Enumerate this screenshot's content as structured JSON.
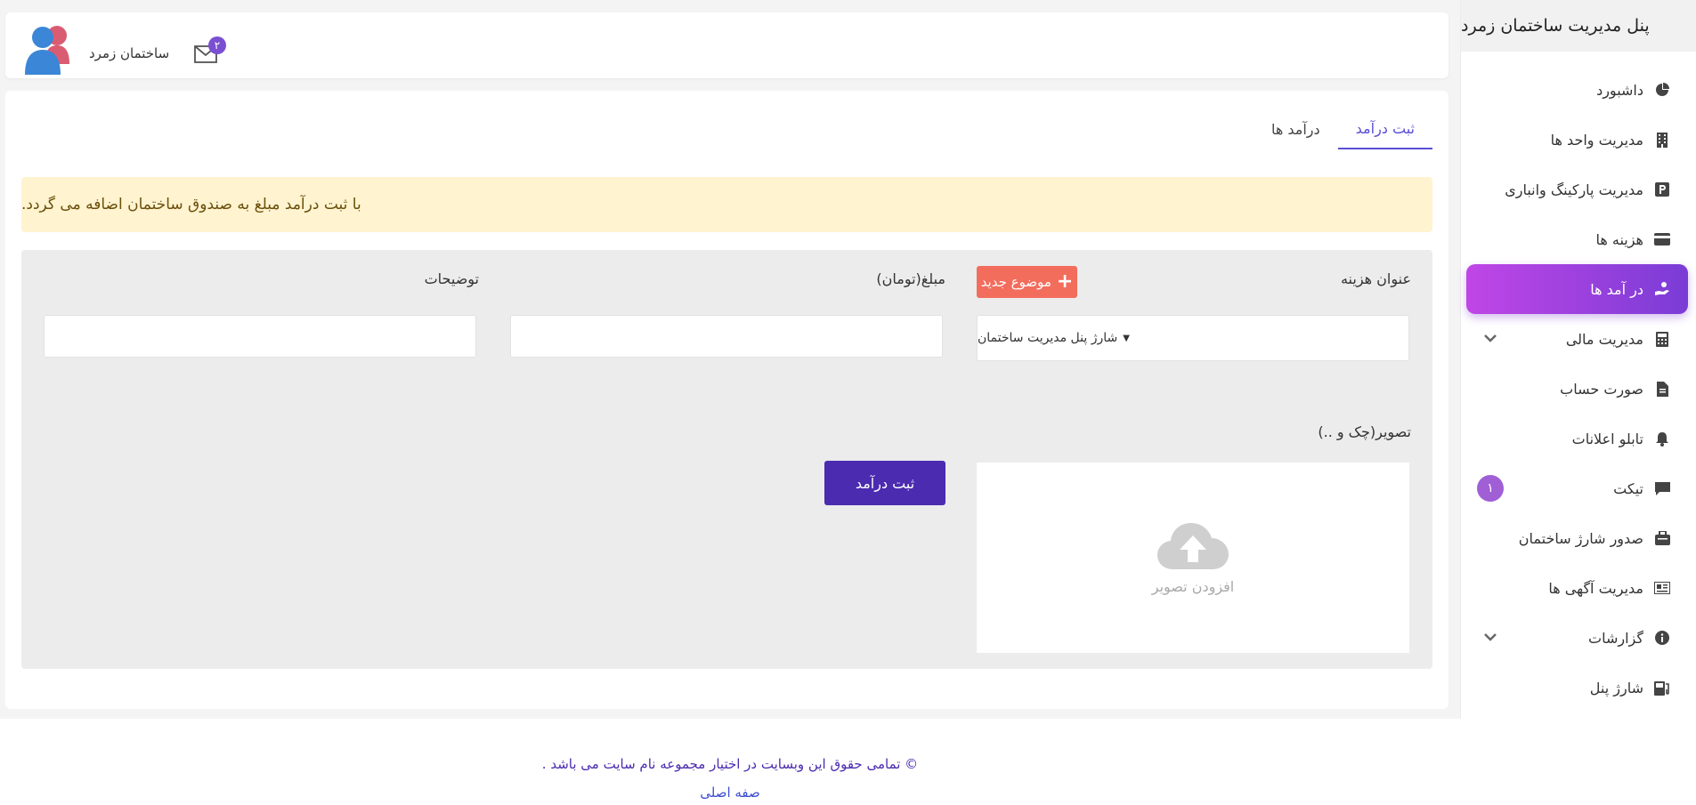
{
  "app": {
    "title": "پنل مدیریت ساختمان زمرد"
  },
  "sidebar": {
    "items": [
      {
        "label": "داشبورد",
        "icon": "pie-chart-icon"
      },
      {
        "label": "مدیریت واحد ها",
        "icon": "building-icon"
      },
      {
        "label": "مدیریت پارکینگ وانباری",
        "icon": "parking-icon"
      },
      {
        "label": "هزینه ها",
        "icon": "credit-card-icon"
      },
      {
        "label": "در آمد ها",
        "icon": "hand-coin-icon",
        "active": true
      },
      {
        "label": "مدیریت مالی",
        "icon": "calculator-icon",
        "expandable": true
      },
      {
        "label": "صورت حساب",
        "icon": "document-icon"
      },
      {
        "label": "تابلو اعلانات",
        "icon": "bell-icon"
      },
      {
        "label": "تیکت",
        "icon": "chat-icon",
        "badge": "۱"
      },
      {
        "label": "صدور شارژ ساختمان",
        "icon": "briefcase-icon"
      },
      {
        "label": "مدیریت آگهی ها",
        "icon": "newspaper-icon"
      },
      {
        "label": "گزارشات",
        "icon": "info-icon",
        "expandable": true
      },
      {
        "label": "شارژ پنل",
        "icon": "charge-icon"
      }
    ]
  },
  "header": {
    "username": "ساختمان زمرد",
    "mail_count": "۲"
  },
  "tabs": [
    {
      "label": "ثبت درآمد",
      "active": true
    },
    {
      "label": "درآمد ها",
      "active": false
    }
  ],
  "alert": {
    "text": "با ثبت درآمد مبلغ به صندوق ساختمان اضافه می گردد."
  },
  "form": {
    "expense_title_label": "عنوان هزینه",
    "new_topic_label": "موضوع جدید",
    "selected_topic": "شارژ پنل مدیریت ساختمان",
    "amount_label": "مبلغ(تومان)",
    "amount_value": "",
    "description_label": "توضیحات",
    "description_value": "",
    "image_label": "تصویر(چک و ..)",
    "upload_text": "افزودن تصویر",
    "submit_label": "ثبت درآمد"
  },
  "footer": {
    "copyright": "© تمامی حقوق این وبسایت در اختیار مجموعه نام سایت می باشد .",
    "home_link": "صفه اصلی"
  },
  "colors": {
    "accent": "#7a3cd6",
    "accent_gradient_start": "#c046e6",
    "primary_button": "#4b2bb0",
    "new_topic_button": "#f36d5d",
    "alert_bg": "#fff3d0"
  }
}
